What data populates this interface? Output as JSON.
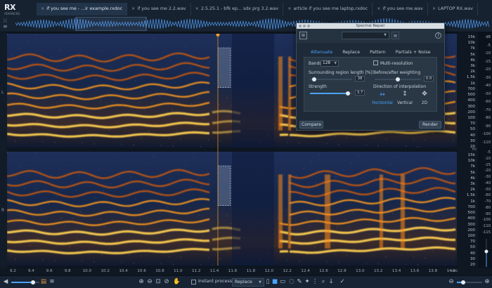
{
  "app": {
    "logo_text": "RX",
    "logo_sub": "ADVANCED"
  },
  "tabs": [
    {
      "label": "if you see me - ...ir example.rxdoc",
      "active": true
    },
    {
      "label": "if you see me 2.2.wav",
      "active": false
    },
    {
      "label": "2.5.25.1 - bfk ep... sdx prg 3.2.wav",
      "active": false
    },
    {
      "label": "article if you see me laptop.rxdoc",
      "active": false
    },
    {
      "label": "if you see me.wav",
      "active": false
    },
    {
      "label": "LAPTOP RX.wav",
      "active": false
    }
  ],
  "channels": {
    "top": "L",
    "bottom": "R"
  },
  "freq_labels": {
    "top": [
      "15k",
      "10k",
      "7k",
      "5k",
      "4k",
      "3k",
      "2k",
      "1.5k",
      "1k",
      "700",
      "500",
      "400",
      "300",
      "200",
      "100",
      "70",
      "50",
      "40",
      "30",
      "20"
    ],
    "bottom": [
      "15k",
      "10k",
      "7k",
      "5k",
      "4k",
      "3k",
      "2k",
      "1.5k",
      "1k",
      "700",
      "500",
      "400",
      "300",
      "200",
      "100",
      "70",
      "50",
      "40",
      "30",
      "20"
    ],
    "unit": "Hz"
  },
  "db_labels": {
    "top": [
      "dB",
      "-5",
      "-10",
      "-15",
      "-20",
      "-30",
      "-40",
      "-50",
      "-60",
      "-70",
      "-80",
      "-90",
      "-100",
      "-110"
    ],
    "bottom": [
      "-5",
      "-10",
      "-15",
      "-20",
      "-30",
      "-40",
      "-50",
      "-60",
      "-70",
      "-80",
      "-90",
      "-100",
      "-110",
      "-115"
    ]
  },
  "time_ticks": [
    "9.2",
    "9.4",
    "9.6",
    "9.8",
    "10.0",
    "10.2",
    "10.4",
    "10.6",
    "10.8",
    "11.0",
    "11.2",
    "11.4",
    "11.6",
    "11.8",
    "12.0",
    "12.2",
    "12.4",
    "12.6",
    "12.8",
    "13.0",
    "13.2",
    "13.4",
    "13.6",
    "13.8",
    "14.0"
  ],
  "time_unit": "sec",
  "bottom_toolbar": {
    "instant_process_label": "Instant process",
    "mode_value": "Replace"
  },
  "dialog": {
    "title": "Spectral Repair",
    "tabs": [
      "Attenuate",
      "Replace",
      "Pattern",
      "Partials + Noise"
    ],
    "active_tab": "Attenuate",
    "bands_label": "Bands",
    "bands_value": "128",
    "multires_label": "Multi-resolution",
    "multires_checked": false,
    "surrounding_label": "Surrounding region length [%]",
    "surrounding_value": "38",
    "surrounding_level": 0.1,
    "weighting_label": "Before/after weighting",
    "weighting_value": "0.0",
    "weighting_level": 0.5,
    "strength_label": "Strength",
    "strength_value": "3.7",
    "strength_level": 0.9,
    "direction_label": "Direction of interpolation",
    "directions": [
      "Horizontal",
      "Vertical",
      "2D"
    ],
    "active_direction": "Horizontal",
    "compare_label": "Compare",
    "render_label": "Render"
  },
  "colors": {
    "accent": "#4aa3ff",
    "spectrogram_hot": "#ff9a1a",
    "spectrogram_cold": "#0a1a3a"
  }
}
